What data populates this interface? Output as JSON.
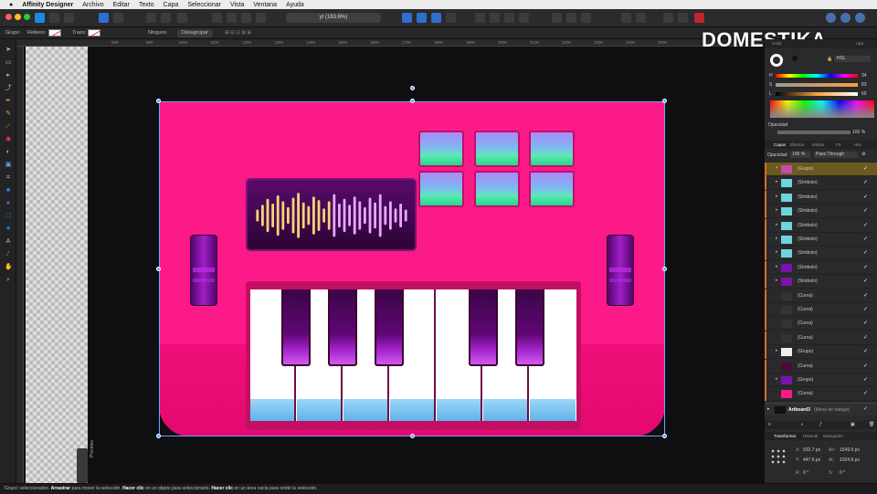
{
  "menubar": {
    "app_name": "Affinity Designer",
    "items": [
      "Archivo",
      "Editar",
      "Texto",
      "Capa",
      "Seleccionar",
      "Vista",
      "Ventana",
      "Ayuda"
    ]
  },
  "toolbar": {
    "document_label": "yt (163.6%)"
  },
  "context_bar": {
    "object_type": "Grupo",
    "fill_label": "Relleno:",
    "stroke_label": "Trazo:",
    "stroke_value": "Ninguno",
    "ungroup_label": "Desagrupar"
  },
  "ruler": {
    "ticks": [
      "800",
      "900",
      "1000",
      "1100",
      "1200",
      "1300",
      "1400",
      "1500",
      "1600",
      "1700",
      "1800",
      "1900",
      "2000",
      "2100",
      "2200",
      "2300",
      "2400",
      "2500"
    ]
  },
  "canvas": {
    "pinceles_label": "Pinceles"
  },
  "artwork": {
    "colors": {
      "body": "#fb1a88",
      "screen": "#3a0646",
      "pad_top": "#a98bf5",
      "pad_bottom": "#27d688",
      "black_key": "#600775",
      "white_key_tip": "#5db3ea"
    },
    "waveform_levels": [
      0.25,
      0.45,
      0.7,
      0.5,
      0.85,
      0.6,
      0.35,
      0.75,
      0.95,
      0.55,
      0.4,
      0.8,
      0.65,
      0.3,
      0.6,
      0.9,
      0.5,
      0.7,
      0.45,
      0.8,
      0.6,
      0.35,
      0.75,
      0.55,
      0.9,
      0.4,
      0.6,
      0.3,
      0.5,
      0.25
    ]
  },
  "logo": {
    "text": "DOMESTIKA"
  },
  "panel": {
    "top_tabs": [
      "Color",
      "Pinceles",
      "Apar.",
      "Trazo",
      "Apa"
    ],
    "color_model": "HSL",
    "hsl": {
      "h_label": "H",
      "h": "34",
      "s_label": "S",
      "s": "83",
      "l_label": "L",
      "l": "69"
    },
    "opacity_label": "Opacidad",
    "opacity_value": "100 %",
    "layer_tabs": [
      "Capas",
      "Efectos",
      "Estilos",
      "FX",
      "Hist"
    ],
    "layer_opacity_label": "Opacidad:",
    "layer_opacity_value": "100 %",
    "blend_mode": "Pass Through",
    "layers": [
      {
        "name": "(Grupo)",
        "selected": true,
        "thumb": "#c84aa8",
        "expand": "▾",
        "level": 0
      },
      {
        "name": "(Símbolo)",
        "thumb": "#6fd3e0",
        "expand": "▸",
        "level": 1
      },
      {
        "name": "(Símbolo)",
        "thumb": "#6fd3e0",
        "expand": "▸",
        "level": 1
      },
      {
        "name": "(Símbolo)",
        "thumb": "#6fd3e0",
        "expand": "▸",
        "level": 1
      },
      {
        "name": "(Símbolo)",
        "thumb": "#6fd3e0",
        "expand": "▸",
        "level": 1
      },
      {
        "name": "(Símbolo)",
        "thumb": "#6fd3e0",
        "expand": "▸",
        "level": 1
      },
      {
        "name": "(Símbolo)",
        "thumb": "#6fd3e0",
        "expand": "▸",
        "level": 1
      },
      {
        "name": "(Símbolo)",
        "thumb": "#7a14a8",
        "expand": "▸",
        "level": 1
      },
      {
        "name": "(Símbolo)",
        "thumb": "#7a14a8",
        "expand": "▸",
        "level": 1
      },
      {
        "name": "(Curva)",
        "thumb": "#333336",
        "expand": "",
        "level": 1
      },
      {
        "name": "(Curva)",
        "thumb": "#333336",
        "expand": "",
        "level": 1
      },
      {
        "name": "(Curva)",
        "thumb": "#333336",
        "expand": "",
        "level": 1
      },
      {
        "name": "(Curva)",
        "thumb": "#333336",
        "expand": "",
        "level": 1
      },
      {
        "name": "(Grupo)",
        "thumb": "#eeeeee",
        "expand": "▸",
        "level": 1
      },
      {
        "name": "(Curva)",
        "thumb": "#4a0a3c",
        "expand": "",
        "level": 1
      },
      {
        "name": "(Grupo)",
        "thumb": "#7a14a8",
        "expand": "▸",
        "level": 1
      },
      {
        "name": "(Curva)",
        "thumb": "#fb1a88",
        "expand": "",
        "level": 1
      }
    ],
    "artboard_name": "Artboard3",
    "artboard_type": "(Mesa de trabajo)",
    "bottom_tabs": [
      "Transformar",
      "Historial",
      "Navegador"
    ],
    "transform": {
      "x_label": "X:",
      "x": "932.7 px",
      "y_label": "Y:",
      "y": "447.6 px",
      "w_label": "An:",
      "w": "1549.5 px",
      "h_label": "Al:",
      "h": "1024.8 px",
      "r_label": "R:",
      "r": "0 °",
      "s_label": "S:",
      "s": "0 °"
    }
  },
  "status": {
    "selected": "'Grupo' seleccionados.",
    "a1": "Arrastrar",
    "t1": "para mover la selección.",
    "a2": "Hacer clic",
    "t2": "en un objeto para seleccionarlo.",
    "a3": "Hacer clic",
    "t3": "en un área vacía para omitir la selección."
  }
}
